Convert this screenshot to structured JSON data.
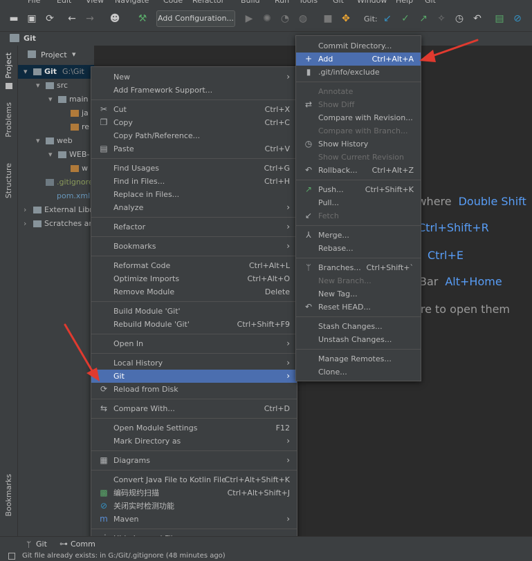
{
  "menubar": [
    "File",
    "Edit",
    "View",
    "Navigate",
    "Code",
    "Refactor",
    "Build",
    "Run",
    "Tools",
    "Git",
    "Window",
    "Help",
    "Git"
  ],
  "toolbar": {
    "add_configuration": "Add Configuration...",
    "git_label": "Git:"
  },
  "breadcrumb": "Git",
  "sidebar_left": {
    "project": "Project",
    "problems": "Problems",
    "structure": "Structure",
    "bookmarks": "Bookmarks"
  },
  "project_panel": {
    "title": "Project",
    "tree": [
      {
        "label": "Git",
        "path": "G:\\Git",
        "indent": 0
      },
      {
        "label": "src",
        "indent": 1
      },
      {
        "label": "main",
        "indent": 2
      },
      {
        "label": "ja",
        "indent": 3
      },
      {
        "label": "re",
        "indent": 3
      },
      {
        "label": "web",
        "indent": 1
      },
      {
        "label": "WEB-",
        "indent": 2
      },
      {
        "label": "w",
        "indent": 3
      },
      {
        "label": ".gitignore",
        "indent": 1
      },
      {
        "label": "pom.xml",
        "indent": 1
      },
      {
        "label": "External Libr",
        "indent": 0
      },
      {
        "label": "Scratches an",
        "indent": 0
      }
    ]
  },
  "editor_hints": [
    {
      "text": "ywhere",
      "shortcut": "Double Shift"
    },
    {
      "text": "",
      "shortcut": "Ctrl+Shift+R"
    },
    {
      "text": "",
      "shortcut": "Ctrl+E"
    },
    {
      "text": "Bar",
      "shortcut": "Alt+Home"
    },
    {
      "text": "ere to open them",
      "shortcut": ""
    }
  ],
  "context_menu": [
    {
      "label": "New",
      "submenu": true
    },
    {
      "label": "Add Framework Support..."
    },
    {
      "sep": true
    },
    {
      "label": "Cut",
      "shortcut": "Ctrl+X",
      "icon": "cut-icon"
    },
    {
      "label": "Copy",
      "shortcut": "Ctrl+C",
      "icon": "copy-icon"
    },
    {
      "label": "Copy Path/Reference..."
    },
    {
      "label": "Paste",
      "shortcut": "Ctrl+V",
      "icon": "paste-icon"
    },
    {
      "sep": true
    },
    {
      "label": "Find Usages",
      "shortcut": "Ctrl+G"
    },
    {
      "label": "Find in Files...",
      "shortcut": "Ctrl+H"
    },
    {
      "label": "Replace in Files..."
    },
    {
      "label": "Analyze",
      "submenu": true
    },
    {
      "sep": true
    },
    {
      "label": "Refactor",
      "submenu": true
    },
    {
      "sep": true
    },
    {
      "label": "Bookmarks",
      "submenu": true
    },
    {
      "sep": true
    },
    {
      "label": "Reformat Code",
      "shortcut": "Ctrl+Alt+L"
    },
    {
      "label": "Optimize Imports",
      "shortcut": "Ctrl+Alt+O"
    },
    {
      "label": "Remove Module",
      "shortcut": "Delete"
    },
    {
      "sep": true
    },
    {
      "label": "Build Module 'Git'"
    },
    {
      "label": "Rebuild Module 'Git'",
      "shortcut": "Ctrl+Shift+F9"
    },
    {
      "sep": true
    },
    {
      "label": "Open In",
      "submenu": true
    },
    {
      "sep": true
    },
    {
      "label": "Local History",
      "submenu": true
    },
    {
      "label": "Git",
      "submenu": true,
      "highlighted": true
    },
    {
      "label": "Reload from Disk",
      "icon": "reload-icon"
    },
    {
      "sep": true
    },
    {
      "label": "Compare With...",
      "shortcut": "Ctrl+D",
      "icon": "compare-icon"
    },
    {
      "sep": true
    },
    {
      "label": "Open Module Settings",
      "shortcut": "F12"
    },
    {
      "label": "Mark Directory as",
      "submenu": true
    },
    {
      "sep": true
    },
    {
      "label": "Diagrams",
      "submenu": true,
      "icon": "diagram-icon"
    },
    {
      "sep": true
    },
    {
      "label": "Convert Java File to Kotlin File",
      "shortcut": "Ctrl+Alt+Shift+K"
    },
    {
      "label": "编码规约扫描",
      "shortcut": "Ctrl+Alt+Shift+J",
      "icon": "scan-icon"
    },
    {
      "label": "关闭实时检测功能",
      "icon": "disable-icon"
    },
    {
      "label": "Maven",
      "submenu": true,
      "icon": "maven-icon"
    },
    {
      "sep": true
    },
    {
      "label": "Hide Ignored Files",
      "icon": "ignore-icon"
    }
  ],
  "git_submenu": [
    {
      "label": "Commit Directory..."
    },
    {
      "label": "Add",
      "shortcut": "Ctrl+Alt+A",
      "highlighted": true,
      "icon": "plus-icon"
    },
    {
      "label": ".git/info/exclude",
      "icon": "file-icon"
    },
    {
      "sep": true
    },
    {
      "label": "Annotate",
      "disabled": true
    },
    {
      "label": "Show Diff",
      "disabled": true,
      "icon": "diff-icon"
    },
    {
      "label": "Compare with Revision..."
    },
    {
      "label": "Compare with Branch...",
      "disabled": true
    },
    {
      "label": "Show History",
      "icon": "history-icon"
    },
    {
      "label": "Show Current Revision",
      "disabled": true
    },
    {
      "label": "Rollback...",
      "shortcut": "Ctrl+Alt+Z",
      "icon": "rollback-icon"
    },
    {
      "sep": true
    },
    {
      "label": "Push...",
      "shortcut": "Ctrl+Shift+K",
      "icon": "push-icon"
    },
    {
      "label": "Pull..."
    },
    {
      "label": "Fetch",
      "disabled": true,
      "icon": "fetch-icon"
    },
    {
      "sep": true
    },
    {
      "label": "Merge...",
      "icon": "merge-icon"
    },
    {
      "label": "Rebase..."
    },
    {
      "sep": true
    },
    {
      "label": "Branches...",
      "shortcut": "Ctrl+Shift+`",
      "icon": "branch-icon"
    },
    {
      "label": "New Branch...",
      "disabled": true
    },
    {
      "label": "New Tag..."
    },
    {
      "label": "Reset HEAD...",
      "icon": "reset-icon"
    },
    {
      "sep": true
    },
    {
      "label": "Stash Changes..."
    },
    {
      "label": "Unstash Changes..."
    },
    {
      "sep": true
    },
    {
      "label": "Manage Remotes..."
    },
    {
      "label": "Clone..."
    }
  ],
  "bottom_tabs": {
    "git": "Git",
    "commit": "Comm"
  },
  "status": "Git file already exists: in G:/Git/.gitignore (48 minutes ago)",
  "colors": {
    "highlight": "#4b6eaf",
    "accent_link": "#589df6",
    "annotation_arrow": "#e03a2f"
  }
}
